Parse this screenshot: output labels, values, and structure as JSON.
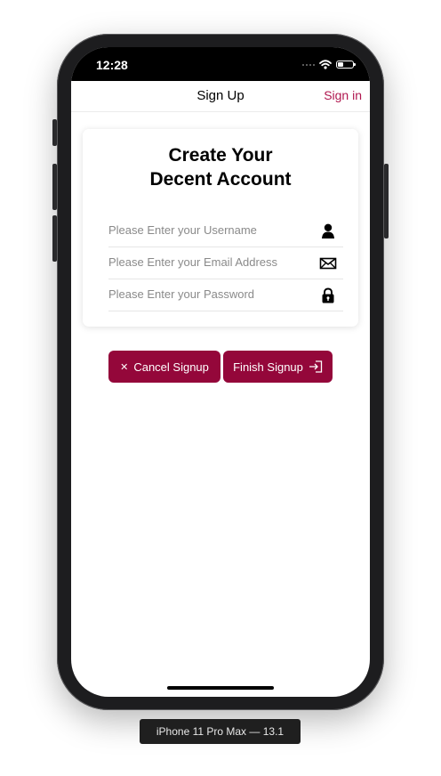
{
  "status_bar": {
    "time": "12:28"
  },
  "nav": {
    "title": "Sign Up",
    "right_link": "Sign in",
    "accent_color": "#b0174f"
  },
  "card": {
    "title": "Create Your Decent Account",
    "fields": [
      {
        "placeholder": "Please Enter your Username",
        "icon": "user-icon"
      },
      {
        "placeholder": "Please Enter your Email Address",
        "icon": "envelope-icon"
      },
      {
        "placeholder": "Please Enter your Password",
        "icon": "lock-icon"
      }
    ]
  },
  "buttons": {
    "cancel": {
      "label": "Cancel Signup",
      "icon_glyph": "✕",
      "icon": "close-icon"
    },
    "finish": {
      "label": "Finish Signup",
      "icon": "sign-in-icon"
    },
    "color": "#94073a"
  },
  "device_label": "iPhone 11 Pro Max — 13.1"
}
